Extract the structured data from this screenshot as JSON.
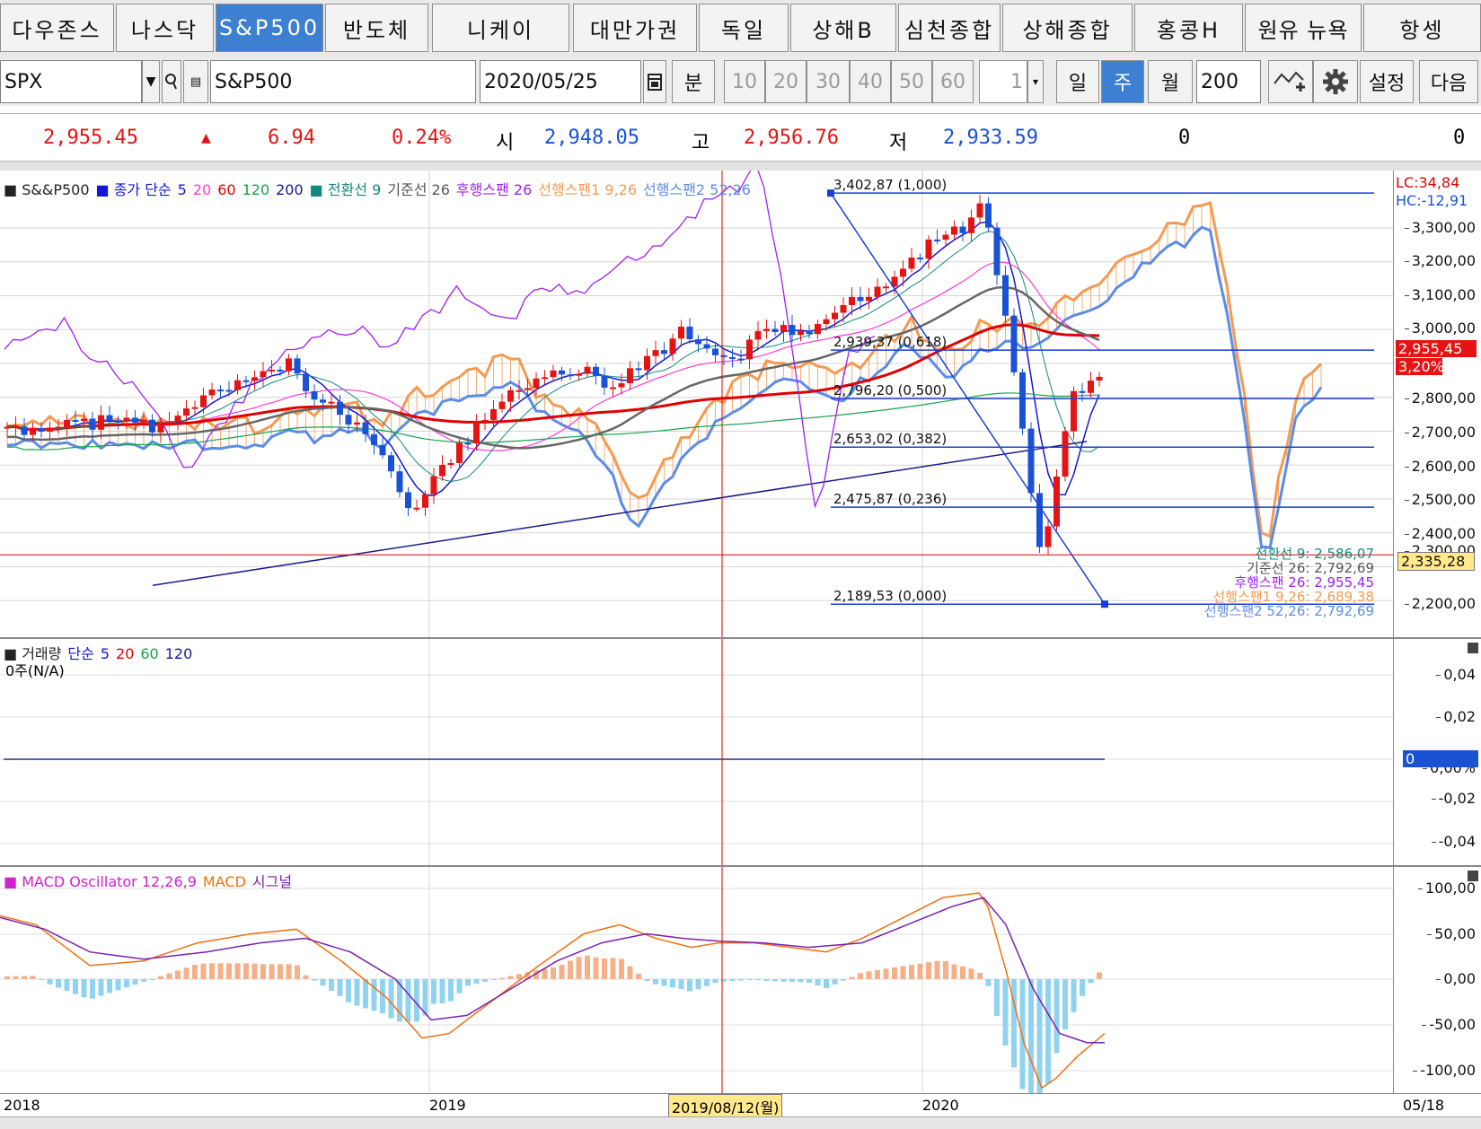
{
  "tabs": [
    "다우존스",
    "나스닥",
    "S&P500",
    "반도체",
    "니케이",
    "대만가권",
    "독일",
    "상해B",
    "심천종합",
    "상해종합",
    "홍콩H",
    "원유 뉴욕",
    "항셍"
  ],
  "active_tab": "S&P500",
  "toolbar": {
    "symbol": "SPX",
    "symbol_name": "S&P500",
    "date": "2020/05/25",
    "minute_label": "분",
    "periods": [
      "10",
      "20",
      "30",
      "40",
      "50",
      "60"
    ],
    "count": "1",
    "day_label": "일",
    "week_label": "주",
    "month_label": "월",
    "bars": "200",
    "settings_label": "설정",
    "next_label": "다음"
  },
  "quote": {
    "price": "2,955.45",
    "change_arrow": "▲",
    "change": "6.94",
    "change_pct": "0.24%",
    "open_label": "시",
    "open": "2,948.05",
    "high_label": "고",
    "high": "2,956.76",
    "low_label": "저",
    "low": "2,933.59",
    "vol1": "0",
    "vol2": "0"
  },
  "price_panel": {
    "legend": [
      {
        "text": "■ S&&P500",
        "color": "#222222"
      },
      {
        "text": "■ 종가 단순",
        "color": "#1515d8"
      },
      {
        "text": "5",
        "color": "#1515d8"
      },
      {
        "text": "20",
        "color": "#ff3ad8"
      },
      {
        "text": "60",
        "color": "#e00000"
      },
      {
        "text": "120",
        "color": "#16a34a"
      },
      {
        "text": "200",
        "color": "#1a1a8c"
      },
      {
        "text": "■ 전환선 9",
        "color": "#0f8a7a"
      },
      {
        "text": "기준선 26",
        "color": "#555555"
      },
      {
        "text": "후행스팬 26",
        "color": "#a020f0"
      },
      {
        "text": "선행스팬1 9,26",
        "color": "#f59a50"
      },
      {
        "text": "선행스팬2 52,26",
        "color": "#5b8ce8"
      }
    ],
    "y_ticks": [
      "3,300,00",
      "3,200,00",
      "3,100,00",
      "3,000,00",
      "2,800,00",
      "2,700,00",
      "2,600,00",
      "2,500,00",
      "2,400,00",
      "2,300,00",
      "2,200,00"
    ],
    "lc": "LC:34,84",
    "hc": "HC:-12,91",
    "price_box": "2,955,45",
    "pct_box": "3,20%",
    "cross_box": "2,335,28",
    "fib_levels": [
      {
        "label": "3,402,87 (1,000)",
        "value": 3402.87
      },
      {
        "label": "2,939,37 (0,618)",
        "value": 2939.37
      },
      {
        "label": "2,796,20 (0,500)",
        "value": 2796.2
      },
      {
        "label": "2,653,02 (0,382)",
        "value": 2653.02
      },
      {
        "label": "2,475,87 (0,236)",
        "value": 2475.87
      },
      {
        "label": "2,189,53 (0,000)",
        "value": 2189.53
      }
    ],
    "right_labels": [
      {
        "text": "전환선 9: 2,586,07",
        "color": "#0f8a7a"
      },
      {
        "text": "기준선 26: 2,792,69",
        "color": "#555555"
      },
      {
        "text": "후행스팬 26: 2,955,45",
        "color": "#a020f0"
      },
      {
        "text": "선행스팬1 9,26: 2,689,38",
        "color": "#f59a50"
      },
      {
        "text": "선행스팬2 52,26: 2,792,69",
        "color": "#5b8ce8"
      }
    ]
  },
  "volume_panel": {
    "legend": [
      {
        "text": "■ 거래량",
        "color": "#222222"
      },
      {
        "text": "단순",
        "color": "#1515d8"
      },
      {
        "text": "5",
        "color": "#1515d8"
      },
      {
        "text": "20",
        "color": "#e00000"
      },
      {
        "text": "60",
        "color": "#16a34a"
      },
      {
        "text": "120",
        "color": "#1a1a8c"
      }
    ],
    "sub_label": "0주(N/A)",
    "y_ticks": [
      "0,04",
      "0,02",
      "0,00%",
      "-0,02",
      "-0,04"
    ],
    "zero_box": "0"
  },
  "macd_panel": {
    "legend": [
      {
        "text": "■ MACD Oscillator 12,26,9",
        "color": "#d020d0"
      },
      {
        "text": "MACD",
        "color": "#f07010"
      },
      {
        "text": "시그널",
        "color": "#7a20b0"
      }
    ],
    "y_ticks": [
      "100,00",
      "50,00",
      "0,00",
      "-50,00",
      "-100,00"
    ]
  },
  "x_axis": {
    "labels": [
      "2018",
      "2019",
      "2020",
      "05/18"
    ],
    "cursor_label": "2019/08/12(월)"
  },
  "colors": {
    "up": "#e41414",
    "down": "#1a52d6",
    "accent": "#3d7fd0"
  }
}
